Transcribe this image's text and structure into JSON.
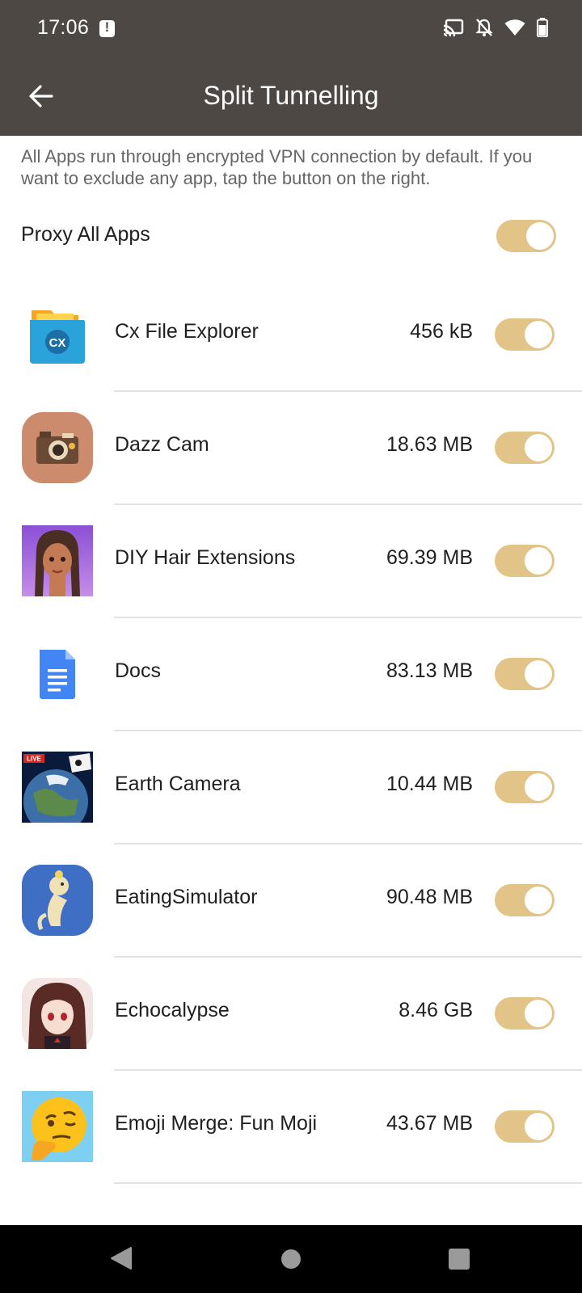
{
  "status_bar": {
    "time": "17:06"
  },
  "header": {
    "title": "Split Tunnelling"
  },
  "description": "All Apps run through encrypted VPN connection by default. If you want to exclude any app, tap the button on the right.",
  "proxy_all": {
    "label": "Proxy All Apps",
    "enabled": true
  },
  "apps": [
    {
      "name": "Cx File Explorer",
      "size": "456 kB",
      "enabled": true
    },
    {
      "name": "Dazz Cam",
      "size": "18.63 MB",
      "enabled": true
    },
    {
      "name": "DIY Hair Extensions",
      "size": "69.39 MB",
      "enabled": true
    },
    {
      "name": "Docs",
      "size": "83.13 MB",
      "enabled": true
    },
    {
      "name": "Earth Camera",
      "size": "10.44 MB",
      "enabled": true
    },
    {
      "name": "EatingSimulator",
      "size": "90.48 MB",
      "enabled": true
    },
    {
      "name": "Echocalypse",
      "size": "8.46 GB",
      "enabled": true
    },
    {
      "name": "Emoji Merge: Fun Moji",
      "size": "43.67 MB",
      "enabled": true
    }
  ],
  "colors": {
    "header_bg": "#4d4844",
    "toggle_on": "#e2c488"
  }
}
